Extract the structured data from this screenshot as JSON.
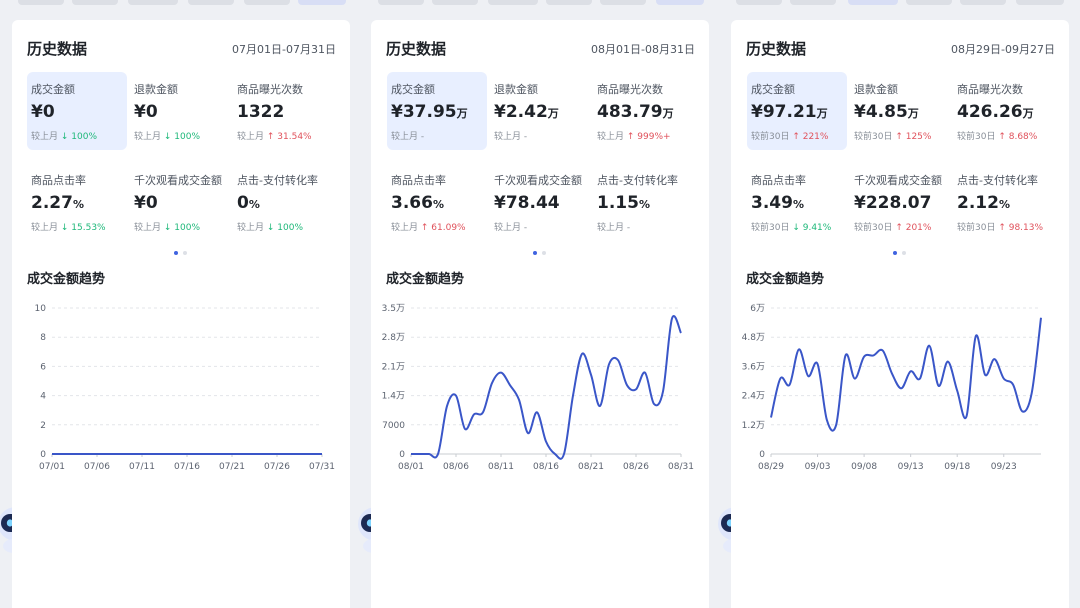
{
  "cards": [
    {
      "title": "历史数据",
      "range": "07月01日-07月31日",
      "metrics": [
        {
          "label": "成交金额",
          "prefix": "¥",
          "value": "0",
          "unit": "",
          "cmp_label": "较上月",
          "cmp_dir": "down",
          "cmp_value": "100%",
          "selected": true
        },
        {
          "label": "退款金额",
          "prefix": "¥",
          "value": "0",
          "unit": "",
          "cmp_label": "较上月",
          "cmp_dir": "down",
          "cmp_value": "100%",
          "selected": false
        },
        {
          "label": "商品曝光次数",
          "prefix": "",
          "value": "1322",
          "unit": "",
          "cmp_label": "较上月",
          "cmp_dir": "up",
          "cmp_value": "31.54%",
          "selected": false
        },
        {
          "label": "商品点击率",
          "prefix": "",
          "value": "2.27",
          "unit": "%",
          "cmp_label": "较上月",
          "cmp_dir": "down",
          "cmp_value": "15.53%",
          "selected": false
        },
        {
          "label": "千次观看成交金额",
          "prefix": "¥",
          "value": "0",
          "unit": "",
          "cmp_label": "较上月",
          "cmp_dir": "down",
          "cmp_value": "100%",
          "selected": false
        },
        {
          "label": "点击-支付转化率",
          "prefix": "",
          "value": "0",
          "unit": "%",
          "cmp_label": "较上月",
          "cmp_dir": "down",
          "cmp_value": "100%",
          "selected": false
        }
      ],
      "trend_title": "成交金额趋势"
    },
    {
      "title": "历史数据",
      "range": "08月01日-08月31日",
      "metrics": [
        {
          "label": "成交金额",
          "prefix": "¥",
          "value": "37.95",
          "unit": "万",
          "cmp_label": "较上月",
          "cmp_dir": "none",
          "cmp_value": "-",
          "selected": true
        },
        {
          "label": "退款金额",
          "prefix": "¥",
          "value": "2.42",
          "unit": "万",
          "cmp_label": "较上月",
          "cmp_dir": "none",
          "cmp_value": "-",
          "selected": false
        },
        {
          "label": "商品曝光次数",
          "prefix": "",
          "value": "483.79",
          "unit": "万",
          "cmp_label": "较上月",
          "cmp_dir": "up",
          "cmp_value": "999%+",
          "selected": false
        },
        {
          "label": "商品点击率",
          "prefix": "",
          "value": "3.66",
          "unit": "%",
          "cmp_label": "较上月",
          "cmp_dir": "up",
          "cmp_value": "61.09%",
          "selected": false
        },
        {
          "label": "千次观看成交金额",
          "prefix": "¥",
          "value": "78.44",
          "unit": "",
          "cmp_label": "较上月",
          "cmp_dir": "none",
          "cmp_value": "-",
          "selected": false
        },
        {
          "label": "点击-支付转化率",
          "prefix": "",
          "value": "1.15",
          "unit": "%",
          "cmp_label": "较上月",
          "cmp_dir": "none",
          "cmp_value": "-",
          "selected": false
        }
      ],
      "trend_title": "成交金额趋势"
    },
    {
      "title": "历史数据",
      "range": "08月29日-09月27日",
      "metrics": [
        {
          "label": "成交金额",
          "prefix": "¥",
          "value": "97.21",
          "unit": "万",
          "cmp_label": "较前30日",
          "cmp_dir": "up",
          "cmp_value": "221%",
          "selected": true
        },
        {
          "label": "退款金额",
          "prefix": "¥",
          "value": "4.85",
          "unit": "万",
          "cmp_label": "较前30日",
          "cmp_dir": "up",
          "cmp_value": "125%",
          "selected": false
        },
        {
          "label": "商品曝光次数",
          "prefix": "",
          "value": "426.26",
          "unit": "万",
          "cmp_label": "较前30日",
          "cmp_dir": "up",
          "cmp_value": "8.68%",
          "selected": false
        },
        {
          "label": "商品点击率",
          "prefix": "",
          "value": "3.49",
          "unit": "%",
          "cmp_label": "较前30日",
          "cmp_dir": "down",
          "cmp_value": "9.41%",
          "selected": false
        },
        {
          "label": "千次观看成交金额",
          "prefix": "¥",
          "value": "228.07",
          "unit": "",
          "cmp_label": "较前30日",
          "cmp_dir": "up",
          "cmp_value": "201%",
          "selected": false
        },
        {
          "label": "点击-支付转化率",
          "prefix": "",
          "value": "2.12",
          "unit": "%",
          "cmp_label": "较前30日",
          "cmp_dir": "up",
          "cmp_value": "98.13%",
          "selected": false
        }
      ],
      "trend_title": "成交金额趋势"
    }
  ],
  "colors": {
    "accent": "#3f63e0",
    "line": "#3a56c8",
    "up": "#e0525c",
    "down": "#1fb87a",
    "grid": "#e3e5e9",
    "selected_bg": "#e8efff"
  },
  "chart_data": [
    {
      "type": "line",
      "ylim": [
        0,
        10
      ],
      "yticks": [
        "0",
        "2",
        "4",
        "6",
        "8",
        "10"
      ],
      "xticks": [
        "07/01",
        "07/06",
        "07/11",
        "07/16",
        "07/21",
        "07/26",
        "07/31"
      ],
      "x": [
        1,
        2,
        3,
        4,
        5,
        6,
        7,
        8,
        9,
        10,
        11,
        12,
        13,
        14,
        15,
        16,
        17,
        18,
        19,
        20,
        21,
        22,
        23,
        24,
        25,
        26,
        27,
        28,
        29,
        30,
        31
      ],
      "series": [
        {
          "values": [
            0,
            0,
            0,
            0,
            0,
            0,
            0,
            0,
            0,
            0,
            0,
            0,
            0,
            0,
            0,
            0,
            0,
            0,
            0,
            0,
            0,
            0,
            0,
            0,
            0,
            0,
            0,
            0,
            0,
            0,
            0
          ]
        }
      ]
    },
    {
      "type": "line",
      "ylim": [
        0,
        35000
      ],
      "yticks": [
        "0",
        "7000",
        "1.4万",
        "2.1万",
        "2.8万",
        "3.5万"
      ],
      "xticks": [
        "08/01",
        "08/06",
        "08/11",
        "08/16",
        "08/21",
        "08/26",
        "08/31"
      ],
      "x": [
        1,
        2,
        3,
        4,
        5,
        6,
        7,
        8,
        9,
        10,
        11,
        12,
        13,
        14,
        15,
        16,
        17,
        18,
        19,
        20,
        21,
        22,
        23,
        24,
        25,
        26,
        27,
        28,
        29,
        30,
        31
      ],
      "series": [
        {
          "values": [
            0,
            0,
            0,
            0,
            11500,
            14000,
            6000,
            9500,
            10000,
            17000,
            19500,
            16500,
            13000,
            5000,
            10000,
            3000,
            0,
            0,
            14000,
            24000,
            19000,
            11500,
            21500,
            22500,
            16500,
            15500,
            19500,
            12000,
            15000,
            32500,
            29000
          ]
        }
      ]
    },
    {
      "type": "line",
      "ylim": [
        0,
        60000
      ],
      "yticks": [
        "0",
        "1.2万",
        "2.4万",
        "3.6万",
        "4.8万",
        "6万"
      ],
      "xticks": [
        "08/29",
        "09/03",
        "09/08",
        "09/13",
        "09/18",
        "09/23"
      ],
      "x": [
        1,
        2,
        3,
        4,
        5,
        6,
        7,
        8,
        9,
        10,
        11,
        12,
        13,
        14,
        15,
        16,
        17,
        18,
        19,
        20,
        21,
        22,
        23,
        24,
        25,
        26,
        27,
        28,
        29,
        30
      ],
      "series": [
        {
          "values": [
            15000,
            31000,
            28500,
            43000,
            32000,
            37000,
            14000,
            12000,
            40500,
            31000,
            40000,
            40500,
            42500,
            33000,
            27000,
            34000,
            31000,
            44500,
            28000,
            38000,
            26000,
            15500,
            48500,
            32500,
            39000,
            31000,
            28500,
            17500,
            25000,
            56000
          ]
        }
      ]
    }
  ]
}
